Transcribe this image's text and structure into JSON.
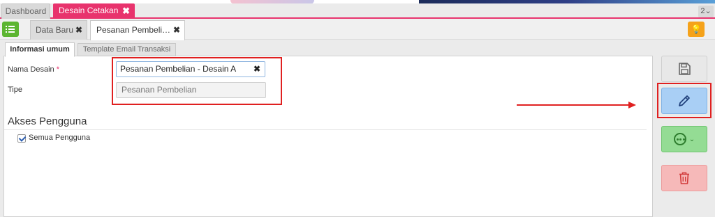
{
  "top_tabs": [
    {
      "label": "Dashboard"
    },
    {
      "label": "Desain Cetakan",
      "close": "✖"
    }
  ],
  "window_count": "2",
  "window_count_chevron": "⌄",
  "sub_tabs": [
    {
      "label": "Data Baru",
      "close": "✖"
    },
    {
      "label": "Pesanan Pembeli…",
      "close": "✖"
    }
  ],
  "bulb_icon_char": "💡",
  "form_tabs": [
    "Informasi umum",
    "Template Email Transaksi"
  ],
  "form": {
    "nama_label": "Nama Desain",
    "required_mark": "*",
    "nama_value": "Pesanan Pembelian - Desain A",
    "clear_char": "✖",
    "tipe_label": "Tipe",
    "tipe_value": "Pesanan Pembelian"
  },
  "akses": {
    "title": "Akses Pengguna",
    "checkbox_label": "Semua Pengguna",
    "checked": true
  },
  "colors": {
    "accent": "#e8336d",
    "highlight": "#e02020",
    "menu_green": "#5cb531",
    "bulb_orange": "#f5a21a"
  }
}
